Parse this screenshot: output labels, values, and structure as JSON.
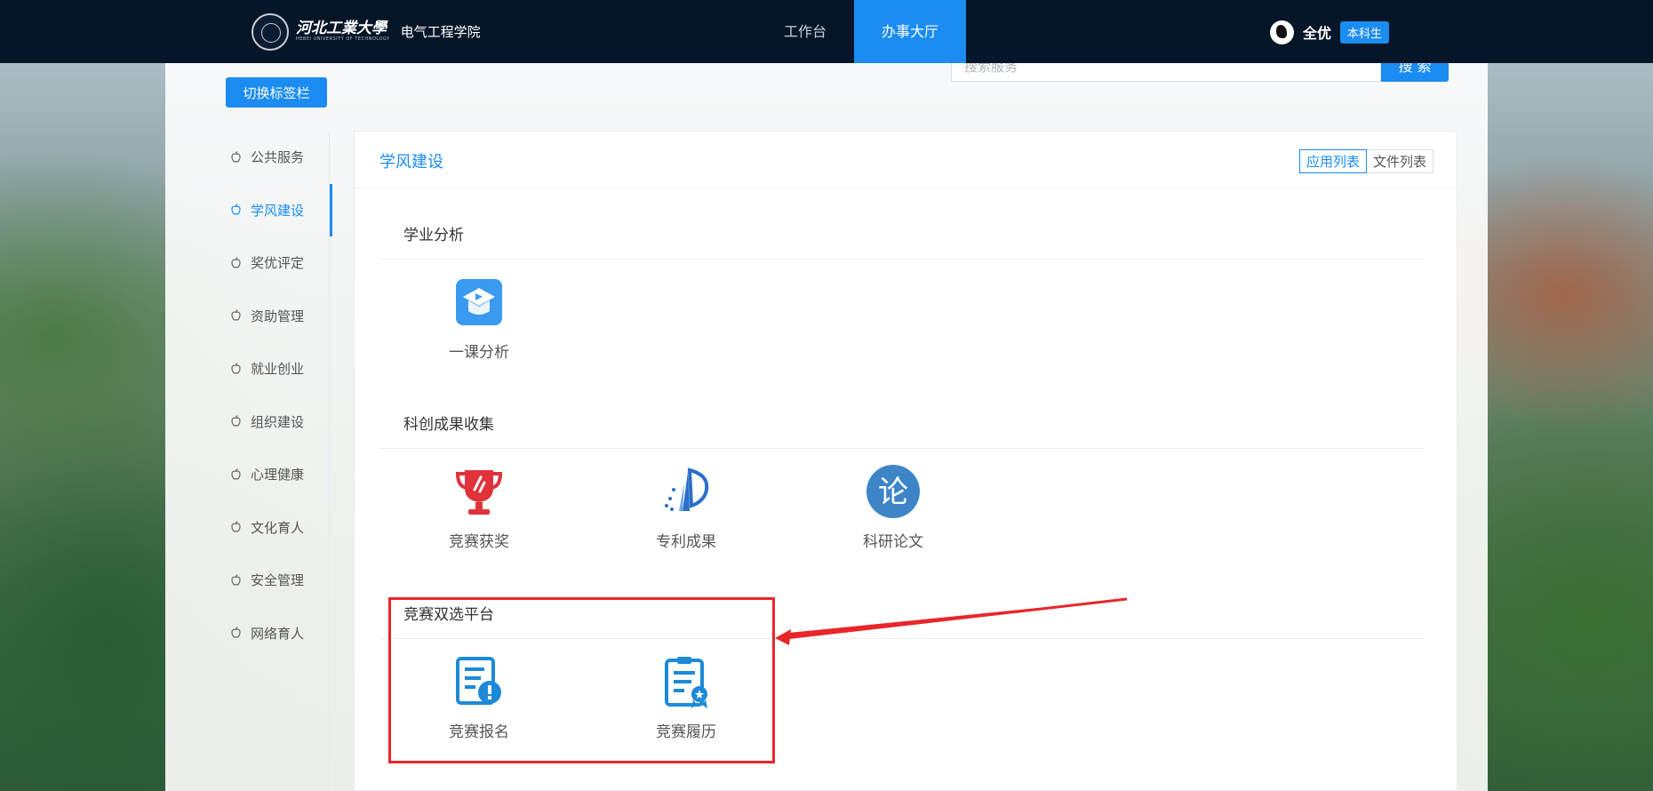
{
  "header": {
    "university_name": "河北工業大學",
    "university_sub": "HEBEI UNIVERSITY OF TECHNOLOGY",
    "college": "电气工程学院",
    "nav_tabs": [
      {
        "label": "工作台",
        "active": false
      },
      {
        "label": "办事大厅",
        "active": true
      }
    ],
    "user": {
      "name": "全优",
      "role_badge": "本科生"
    }
  },
  "toolbar": {
    "switch_label": "切换标签栏",
    "search_placeholder": "搜索服务",
    "search_button": "搜 索"
  },
  "sidebar": {
    "items": [
      {
        "label": "公共服务",
        "active": false
      },
      {
        "label": "学风建设",
        "active": true
      },
      {
        "label": "奖优评定",
        "active": false
      },
      {
        "label": "资助管理",
        "active": false
      },
      {
        "label": "就业创业",
        "active": false
      },
      {
        "label": "组织建设",
        "active": false
      },
      {
        "label": "心理健康",
        "active": false
      },
      {
        "label": "文化育人",
        "active": false
      },
      {
        "label": "安全管理",
        "active": false
      },
      {
        "label": "网络育人",
        "active": false
      }
    ]
  },
  "main": {
    "title": "学风建设",
    "view_options": [
      {
        "label": "应用列表",
        "selected": true
      },
      {
        "label": "文件列表",
        "selected": false
      }
    ],
    "sections": [
      {
        "title": "学业分析",
        "apps": [
          {
            "label": "一课分析",
            "icon": "graduation-cap-icon"
          }
        ]
      },
      {
        "title": "科创成果收集",
        "apps": [
          {
            "label": "竞赛获奖",
            "icon": "trophy-icon"
          },
          {
            "label": "专利成果",
            "icon": "patent-logo-icon"
          },
          {
            "label": "科研论文",
            "icon": "thesis-icon",
            "icon_text": "论"
          }
        ]
      },
      {
        "title": "竞赛双选平台",
        "apps": [
          {
            "label": "竞赛报名",
            "icon": "registration-form-icon"
          },
          {
            "label": "竞赛履历",
            "icon": "resume-clipboard-icon"
          }
        ]
      }
    ]
  },
  "colors": {
    "primary": "#1b8cf1",
    "navbar": "#061628",
    "annotation_red": "#e8262a"
  }
}
